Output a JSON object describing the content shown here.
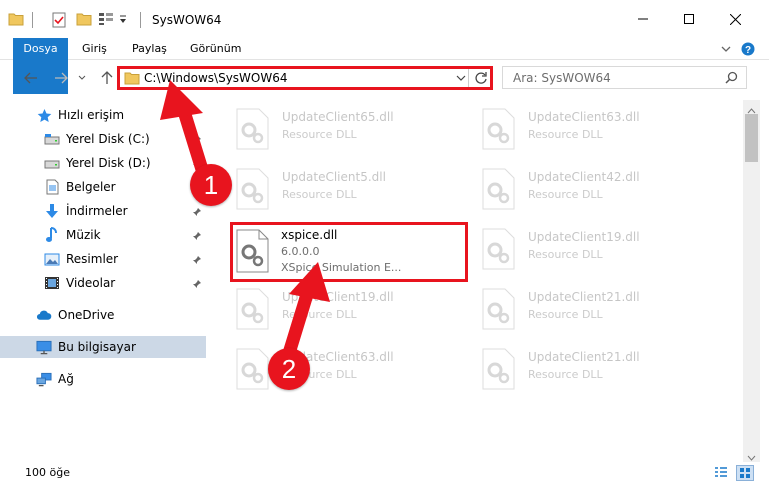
{
  "window": {
    "title": "SysWOW64"
  },
  "ribbon": {
    "tabs": [
      "Dosya",
      "Giriş",
      "Paylaş",
      "Görünüm"
    ]
  },
  "address": {
    "path": "C:\\Windows\\SysWOW64"
  },
  "search": {
    "placeholder": "Ara: SysWOW64"
  },
  "sidebar": {
    "quick_access": "Hızlı erişim",
    "items": [
      {
        "label": "Yerel Disk (C:)",
        "icon": "drive-icon"
      },
      {
        "label": "Yerel Disk (D:)",
        "icon": "drive-icon"
      },
      {
        "label": "Belgeler",
        "icon": "documents-icon"
      },
      {
        "label": "İndirmeler",
        "icon": "downloads-icon"
      },
      {
        "label": "Müzik",
        "icon": "music-icon"
      },
      {
        "label": "Resimler",
        "icon": "pictures-icon"
      },
      {
        "label": "Videolar",
        "icon": "videos-icon"
      }
    ],
    "onedrive": "OneDrive",
    "this_pc": "Bu bilgisayar",
    "network": "Ağ"
  },
  "files": {
    "left": [
      {
        "name": "UpdateClient65.dll",
        "type": "Resource DLL"
      },
      {
        "name": "UpdateClient5.dll",
        "type": "Resource DLL"
      },
      {
        "name": "xspice.dll",
        "version": "6.0.0.0",
        "desc": "XSpice Simulation E..."
      },
      {
        "name": "UpdateClient19.dll",
        "type": "Resource DLL"
      },
      {
        "name": "UpdateClient63.dll",
        "type": "Resource DLL"
      }
    ],
    "right": [
      {
        "name": "UpdateClient63.dll",
        "type": "Resource DLL"
      },
      {
        "name": "UpdateClient42.dll",
        "type": "Resource DLL"
      },
      {
        "name": "UpdateClient19.dll",
        "type": "Resource DLL"
      },
      {
        "name": "UpdateClient21.dll",
        "type": "Resource DLL"
      },
      {
        "name": "UpdateClient21.dll",
        "type": "Resource DLL"
      }
    ]
  },
  "status": {
    "count": "100 öğe"
  },
  "annotations": {
    "step1": "1",
    "step2": "2"
  },
  "colors": {
    "accent": "#1979ca",
    "highlight": "#e8141e",
    "selected": "#ccd8e6"
  }
}
